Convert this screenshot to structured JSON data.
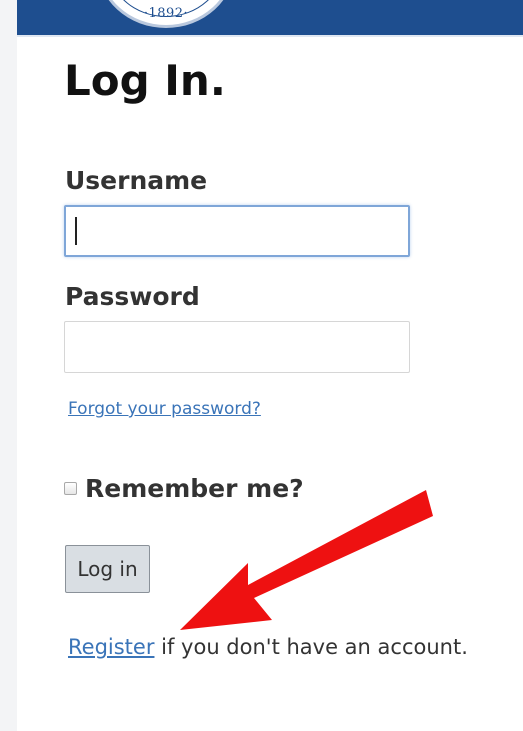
{
  "header": {
    "seal_year": "·1892·",
    "color": "#1e4e8f"
  },
  "page": {
    "title": "Log In."
  },
  "form": {
    "username_label": "Username",
    "username_value": "",
    "password_label": "Password",
    "password_value": "",
    "forgot_link": "Forgot your password?",
    "remember_label": "Remember me?",
    "remember_checked": false,
    "login_button": "Log in",
    "register_link": "Register",
    "register_suffix": " if you don't have an account."
  },
  "annotation": {
    "arrow_color": "#ee1111"
  }
}
